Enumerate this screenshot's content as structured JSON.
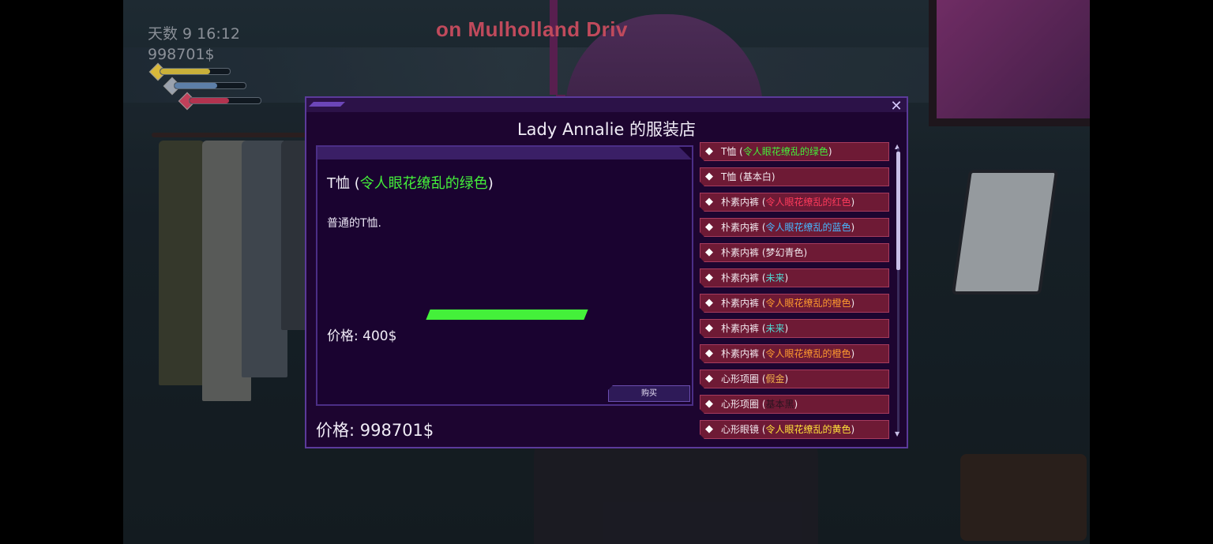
{
  "hud": {
    "day_time": "天数 9 16:12",
    "money": "998701$",
    "energy_level": 0.72,
    "health_level": 0.6,
    "heart_level": 0.55
  },
  "location": "on Mulholland Driv",
  "shop": {
    "title": "Lady Annalie 的服装店",
    "close_icon": "close-icon",
    "selected": {
      "name_prefix": "T恤 (",
      "name_color": "令人眼花缭乱的绿色",
      "name_suffix": ")",
      "name_color_hex": "#44f03a",
      "description": "普通的T恤.",
      "progress": 1.0,
      "price": "价格: 400$"
    },
    "buy_label": "购买",
    "player_money": "价格: 998701$",
    "items": [
      {
        "prefix": "T恤 (",
        "color": "令人眼花缭乱的绿色",
        "suffix": ")",
        "hex": "#44f03a"
      },
      {
        "prefix": "T恤 (",
        "color": "基本白",
        "suffix": ")",
        "hex": "#f2e8ee"
      },
      {
        "prefix": "朴素内裤 (",
        "color": "令人眼花缭乱的红色",
        "suffix": ")",
        "hex": "#ff3b5c"
      },
      {
        "prefix": "朴素内裤 (",
        "color": "令人眼花缭乱的蓝色",
        "suffix": ")",
        "hex": "#47b8ff"
      },
      {
        "prefix": "朴素内裤 (",
        "color": "梦幻青色",
        "suffix": ")",
        "hex": "#f2e8ee"
      },
      {
        "prefix": "朴素内裤 (",
        "color": "未来",
        "suffix": ")",
        "hex": "#4fd8d0"
      },
      {
        "prefix": "朴素内裤 (",
        "color": "令人眼花缭乱的橙色",
        "suffix": ")",
        "hex": "#ff9b2e"
      },
      {
        "prefix": "朴素内裤 (",
        "color": "未来",
        "suffix": ")",
        "hex": "#4fd8d0"
      },
      {
        "prefix": "朴素内裤 (",
        "color": "令人眼花缭乱的橙色",
        "suffix": ")",
        "hex": "#ff9b2e"
      },
      {
        "prefix": "心形项圈 (",
        "color": "假金",
        "suffix": ")",
        "hex": "#f2b24a"
      },
      {
        "prefix": "心形项圈 (",
        "color": "基本黑",
        "suffix": ")",
        "hex": "#2a1420"
      },
      {
        "prefix": "心形眼镜 (",
        "color": "令人眼花缭乱的黄色",
        "suffix": ")",
        "hex": "#ffe23a"
      }
    ]
  }
}
